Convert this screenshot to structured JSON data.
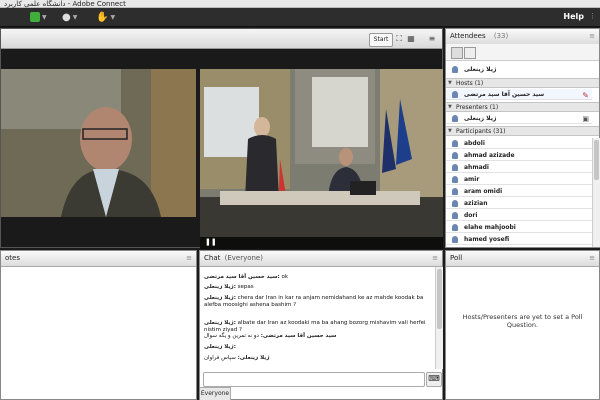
{
  "window": {
    "title": "دانشگاه علمی کاربرد - Adobe Connect"
  },
  "menubar": {
    "help_label": "Help"
  },
  "video": {
    "start_label": "Start"
  },
  "attendees": {
    "title": "Attendees",
    "count": "(33)",
    "current_user": "ژیلا زینعلی",
    "hosts_label": "Hosts (1)",
    "hosts": [
      "سید حسین آقا سید مرتضی"
    ],
    "presenters_label": "Presenters (1)",
    "presenters": [
      "ژیلا زینعلی"
    ],
    "participants_label": "Participants (31)",
    "participants": [
      "abdoli",
      "ahmad azizade",
      "ahmadi",
      "amir",
      "aram omidi",
      "azizian",
      "dori",
      "elahe mahjoobi",
      "hamed yosefi"
    ]
  },
  "notes": {
    "title": "otes"
  },
  "chat": {
    "title": "Chat",
    "scope": "(Everyone)",
    "messages": [
      {
        "author": "سید حسین آقا سید مرتضی:",
        "text": "ok"
      },
      {
        "author": "ژیلا زینعلی:",
        "text": "sepas"
      },
      {
        "author": "ژیلا زینعلی:",
        "text": "chera dar Iran in kar ra anjam nemidahand ke az mahde koodak ba alefba moosighi ashena bashim ?"
      },
      {
        "author": "ژیلا زینعلی:",
        "text": "albate dar Iran az koodaki ma ba ahang bozorg mishavim vali herfei nistim ziyad ?"
      },
      {
        "author": "سید حسین آقا سید مرتضی:",
        "text": "دو نه تمرین و یگه سوال"
      },
      {
        "author": "ژیلا زینعلی:",
        "text": ""
      },
      {
        "author": "ژیلا زینعلی:",
        "text": "سپاس فراوان"
      }
    ],
    "tab_label": "Everyone"
  },
  "poll": {
    "title": "Poll",
    "message": "Hosts/Presenters are yet to set a Poll Question."
  }
}
